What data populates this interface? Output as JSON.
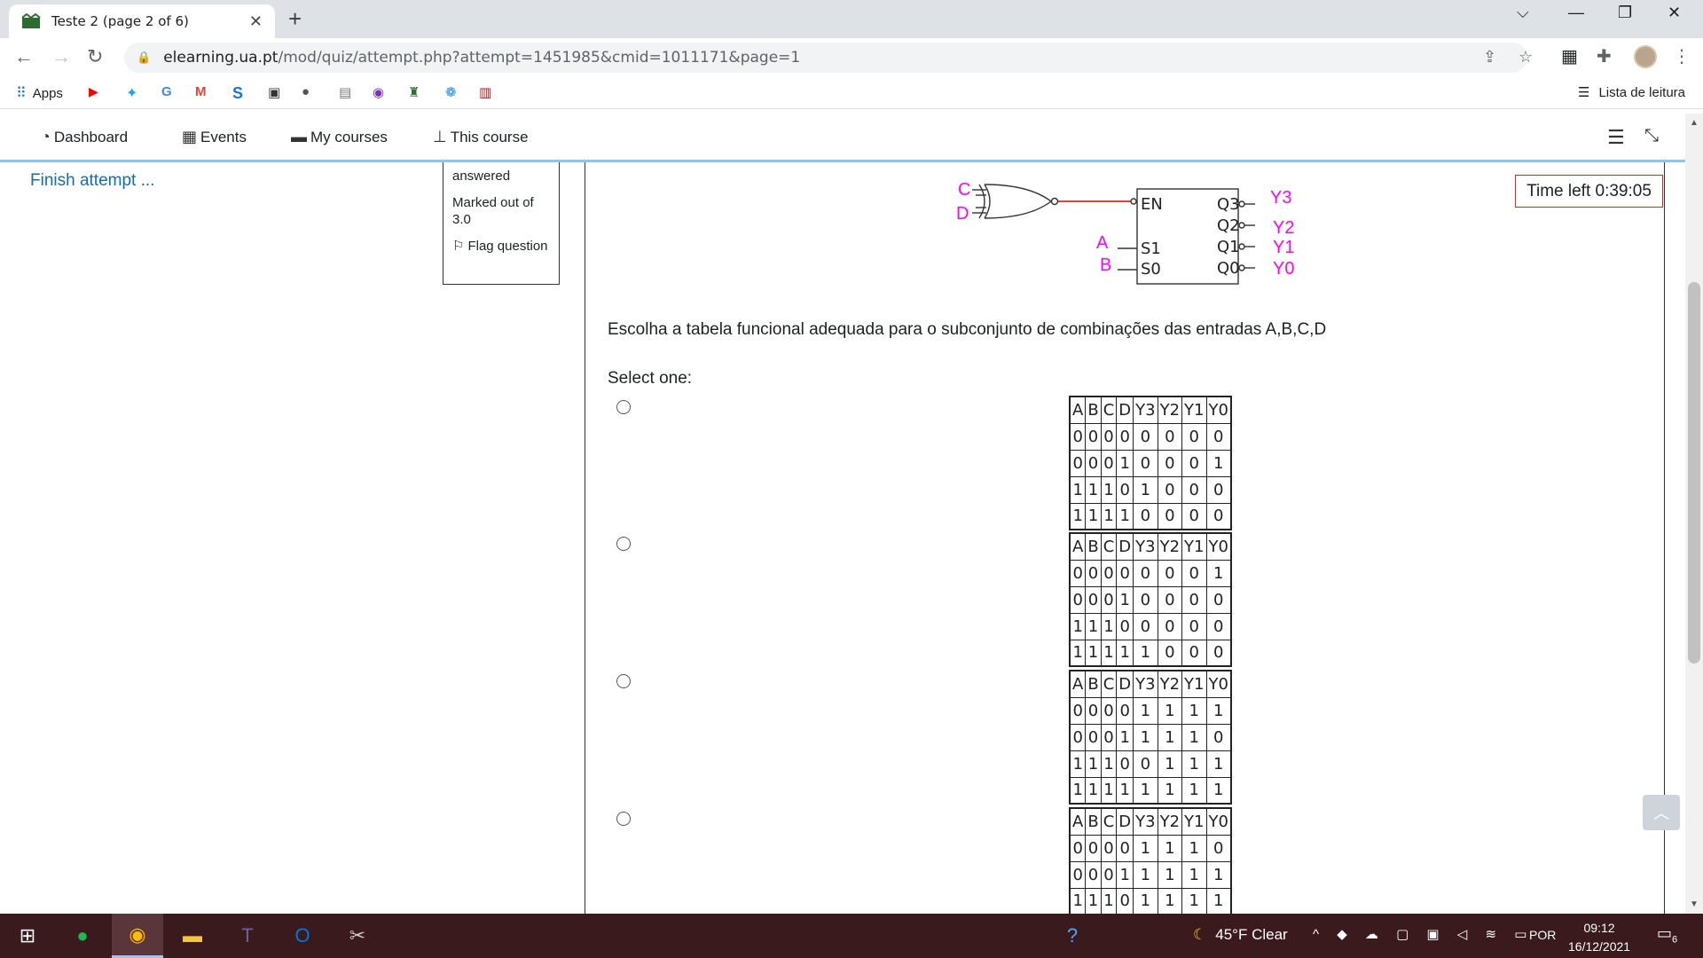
{
  "browser": {
    "tab_title": "Teste 2 (page 2 of 6)",
    "url_host": "elearning.ua.pt",
    "url_path": "/mod/quiz/attempt.php?attempt=1451985&cmid=1011171&page=1",
    "bookmarks_apps": "Apps",
    "reading_list": "Lista de leitura"
  },
  "navbar": {
    "items": [
      {
        "label": "Dashboard",
        "icon": "tachometer-icon"
      },
      {
        "label": "Events",
        "icon": "calendar-icon"
      },
      {
        "label": "My courses",
        "icon": "briefcase-icon"
      },
      {
        "label": "This course",
        "icon": "sitemap-icon"
      }
    ]
  },
  "sidebar": {
    "finish_attempt": "Finish attempt ..."
  },
  "question_info": {
    "status": "answered",
    "marked": "Marked out of 3.0",
    "flag": "Flag question"
  },
  "timer": "Time left 0:39:05",
  "circuit": {
    "inputs": [
      "C",
      "D"
    ],
    "selects": [
      "A",
      "B"
    ],
    "block_labels": [
      "EN",
      "S1",
      "S0",
      "Q3",
      "Q2",
      "Q1",
      "Q0"
    ],
    "outputs": [
      "Y3",
      "Y2",
      "Y1",
      "Y0"
    ]
  },
  "question": {
    "prompt": "Escolha a tabela funcional adequada para o subconjunto de combinações das entradas A,B,C,D",
    "select_one": "Select one:",
    "header": [
      "A",
      "B",
      "C",
      "D",
      "Y3",
      "Y2",
      "Y1",
      "Y0"
    ],
    "options": [
      [
        [
          "0",
          "0",
          "0",
          "0",
          "0",
          "0",
          "0",
          "0"
        ],
        [
          "0",
          "0",
          "0",
          "1",
          "0",
          "0",
          "0",
          "1"
        ],
        [
          "1",
          "1",
          "1",
          "0",
          "1",
          "0",
          "0",
          "0"
        ],
        [
          "1",
          "1",
          "1",
          "1",
          "0",
          "0",
          "0",
          "0"
        ]
      ],
      [
        [
          "0",
          "0",
          "0",
          "0",
          "0",
          "0",
          "0",
          "1"
        ],
        [
          "0",
          "0",
          "0",
          "1",
          "0",
          "0",
          "0",
          "0"
        ],
        [
          "1",
          "1",
          "1",
          "0",
          "0",
          "0",
          "0",
          "0"
        ],
        [
          "1",
          "1",
          "1",
          "1",
          "1",
          "0",
          "0",
          "0"
        ]
      ],
      [
        [
          "0",
          "0",
          "0",
          "0",
          "1",
          "1",
          "1",
          "1"
        ],
        [
          "0",
          "0",
          "0",
          "1",
          "1",
          "1",
          "1",
          "0"
        ],
        [
          "1",
          "1",
          "1",
          "0",
          "0",
          "1",
          "1",
          "1"
        ],
        [
          "1",
          "1",
          "1",
          "1",
          "1",
          "1",
          "1",
          "1"
        ]
      ],
      [
        [
          "0",
          "0",
          "0",
          "0",
          "1",
          "1",
          "1",
          "0"
        ],
        [
          "0",
          "0",
          "0",
          "1",
          "1",
          "1",
          "1",
          "1"
        ],
        [
          "1",
          "1",
          "1",
          "0",
          "1",
          "1",
          "1",
          "1"
        ]
      ]
    ]
  },
  "taskbar": {
    "weather": "45°F  Clear",
    "language": "POR",
    "time": "09:12",
    "date": "16/12/2021",
    "notifications": "6"
  },
  "colors": {
    "link": "#0f6cbf",
    "circuit_accent": "#ff00ff",
    "timer_border": "#ca3120",
    "taskbar": "#3b1a1e"
  }
}
